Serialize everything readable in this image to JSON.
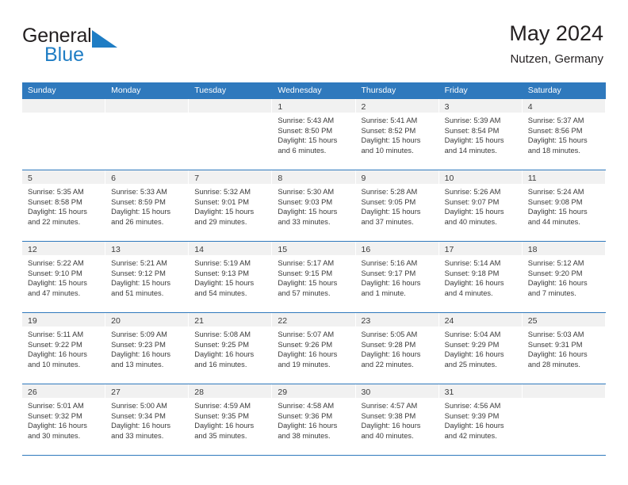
{
  "logo": {
    "word_general": "General",
    "word_blue": "Blue",
    "flag_color": "#1f7dc4",
    "icon": "general-blue-flag-icon"
  },
  "header": {
    "title": "May 2024",
    "subtitle": "Nutzen, Germany"
  },
  "theme": {
    "header_band": "#2f79bd",
    "date_band": "#f1f1f1",
    "text": "#3a3a3a",
    "accent": "#1f7dc4"
  },
  "calendar": {
    "weekdays": [
      "Sunday",
      "Monday",
      "Tuesday",
      "Wednesday",
      "Thursday",
      "Friday",
      "Saturday"
    ],
    "leading_blanks": 3,
    "weeks": [
      [
        {
          "blank": true
        },
        {
          "blank": true
        },
        {
          "blank": true
        },
        {
          "day": "1",
          "sunrise": "Sunrise: 5:43 AM",
          "sunset": "Sunset: 8:50 PM",
          "daylight_1": "Daylight: 15 hours",
          "daylight_2": "and 6 minutes."
        },
        {
          "day": "2",
          "sunrise": "Sunrise: 5:41 AM",
          "sunset": "Sunset: 8:52 PM",
          "daylight_1": "Daylight: 15 hours",
          "daylight_2": "and 10 minutes."
        },
        {
          "day": "3",
          "sunrise": "Sunrise: 5:39 AM",
          "sunset": "Sunset: 8:54 PM",
          "daylight_1": "Daylight: 15 hours",
          "daylight_2": "and 14 minutes."
        },
        {
          "day": "4",
          "sunrise": "Sunrise: 5:37 AM",
          "sunset": "Sunset: 8:56 PM",
          "daylight_1": "Daylight: 15 hours",
          "daylight_2": "and 18 minutes."
        }
      ],
      [
        {
          "day": "5",
          "sunrise": "Sunrise: 5:35 AM",
          "sunset": "Sunset: 8:58 PM",
          "daylight_1": "Daylight: 15 hours",
          "daylight_2": "and 22 minutes."
        },
        {
          "day": "6",
          "sunrise": "Sunrise: 5:33 AM",
          "sunset": "Sunset: 8:59 PM",
          "daylight_1": "Daylight: 15 hours",
          "daylight_2": "and 26 minutes."
        },
        {
          "day": "7",
          "sunrise": "Sunrise: 5:32 AM",
          "sunset": "Sunset: 9:01 PM",
          "daylight_1": "Daylight: 15 hours",
          "daylight_2": "and 29 minutes."
        },
        {
          "day": "8",
          "sunrise": "Sunrise: 5:30 AM",
          "sunset": "Sunset: 9:03 PM",
          "daylight_1": "Daylight: 15 hours",
          "daylight_2": "and 33 minutes."
        },
        {
          "day": "9",
          "sunrise": "Sunrise: 5:28 AM",
          "sunset": "Sunset: 9:05 PM",
          "daylight_1": "Daylight: 15 hours",
          "daylight_2": "and 37 minutes."
        },
        {
          "day": "10",
          "sunrise": "Sunrise: 5:26 AM",
          "sunset": "Sunset: 9:07 PM",
          "daylight_1": "Daylight: 15 hours",
          "daylight_2": "and 40 minutes."
        },
        {
          "day": "11",
          "sunrise": "Sunrise: 5:24 AM",
          "sunset": "Sunset: 9:08 PM",
          "daylight_1": "Daylight: 15 hours",
          "daylight_2": "and 44 minutes."
        }
      ],
      [
        {
          "day": "12",
          "sunrise": "Sunrise: 5:22 AM",
          "sunset": "Sunset: 9:10 PM",
          "daylight_1": "Daylight: 15 hours",
          "daylight_2": "and 47 minutes."
        },
        {
          "day": "13",
          "sunrise": "Sunrise: 5:21 AM",
          "sunset": "Sunset: 9:12 PM",
          "daylight_1": "Daylight: 15 hours",
          "daylight_2": "and 51 minutes."
        },
        {
          "day": "14",
          "sunrise": "Sunrise: 5:19 AM",
          "sunset": "Sunset: 9:13 PM",
          "daylight_1": "Daylight: 15 hours",
          "daylight_2": "and 54 minutes."
        },
        {
          "day": "15",
          "sunrise": "Sunrise: 5:17 AM",
          "sunset": "Sunset: 9:15 PM",
          "daylight_1": "Daylight: 15 hours",
          "daylight_2": "and 57 minutes."
        },
        {
          "day": "16",
          "sunrise": "Sunrise: 5:16 AM",
          "sunset": "Sunset: 9:17 PM",
          "daylight_1": "Daylight: 16 hours",
          "daylight_2": "and 1 minute."
        },
        {
          "day": "17",
          "sunrise": "Sunrise: 5:14 AM",
          "sunset": "Sunset: 9:18 PM",
          "daylight_1": "Daylight: 16 hours",
          "daylight_2": "and 4 minutes."
        },
        {
          "day": "18",
          "sunrise": "Sunrise: 5:12 AM",
          "sunset": "Sunset: 9:20 PM",
          "daylight_1": "Daylight: 16 hours",
          "daylight_2": "and 7 minutes."
        }
      ],
      [
        {
          "day": "19",
          "sunrise": "Sunrise: 5:11 AM",
          "sunset": "Sunset: 9:22 PM",
          "daylight_1": "Daylight: 16 hours",
          "daylight_2": "and 10 minutes."
        },
        {
          "day": "20",
          "sunrise": "Sunrise: 5:09 AM",
          "sunset": "Sunset: 9:23 PM",
          "daylight_1": "Daylight: 16 hours",
          "daylight_2": "and 13 minutes."
        },
        {
          "day": "21",
          "sunrise": "Sunrise: 5:08 AM",
          "sunset": "Sunset: 9:25 PM",
          "daylight_1": "Daylight: 16 hours",
          "daylight_2": "and 16 minutes."
        },
        {
          "day": "22",
          "sunrise": "Sunrise: 5:07 AM",
          "sunset": "Sunset: 9:26 PM",
          "daylight_1": "Daylight: 16 hours",
          "daylight_2": "and 19 minutes."
        },
        {
          "day": "23",
          "sunrise": "Sunrise: 5:05 AM",
          "sunset": "Sunset: 9:28 PM",
          "daylight_1": "Daylight: 16 hours",
          "daylight_2": "and 22 minutes."
        },
        {
          "day": "24",
          "sunrise": "Sunrise: 5:04 AM",
          "sunset": "Sunset: 9:29 PM",
          "daylight_1": "Daylight: 16 hours",
          "daylight_2": "and 25 minutes."
        },
        {
          "day": "25",
          "sunrise": "Sunrise: 5:03 AM",
          "sunset": "Sunset: 9:31 PM",
          "daylight_1": "Daylight: 16 hours",
          "daylight_2": "and 28 minutes."
        }
      ],
      [
        {
          "day": "26",
          "sunrise": "Sunrise: 5:01 AM",
          "sunset": "Sunset: 9:32 PM",
          "daylight_1": "Daylight: 16 hours",
          "daylight_2": "and 30 minutes."
        },
        {
          "day": "27",
          "sunrise": "Sunrise: 5:00 AM",
          "sunset": "Sunset: 9:34 PM",
          "daylight_1": "Daylight: 16 hours",
          "daylight_2": "and 33 minutes."
        },
        {
          "day": "28",
          "sunrise": "Sunrise: 4:59 AM",
          "sunset": "Sunset: 9:35 PM",
          "daylight_1": "Daylight: 16 hours",
          "daylight_2": "and 35 minutes."
        },
        {
          "day": "29",
          "sunrise": "Sunrise: 4:58 AM",
          "sunset": "Sunset: 9:36 PM",
          "daylight_1": "Daylight: 16 hours",
          "daylight_2": "and 38 minutes."
        },
        {
          "day": "30",
          "sunrise": "Sunrise: 4:57 AM",
          "sunset": "Sunset: 9:38 PM",
          "daylight_1": "Daylight: 16 hours",
          "daylight_2": "and 40 minutes."
        },
        {
          "day": "31",
          "sunrise": "Sunrise: 4:56 AM",
          "sunset": "Sunset: 9:39 PM",
          "daylight_1": "Daylight: 16 hours",
          "daylight_2": "and 42 minutes."
        },
        {
          "blank": true
        }
      ]
    ]
  }
}
